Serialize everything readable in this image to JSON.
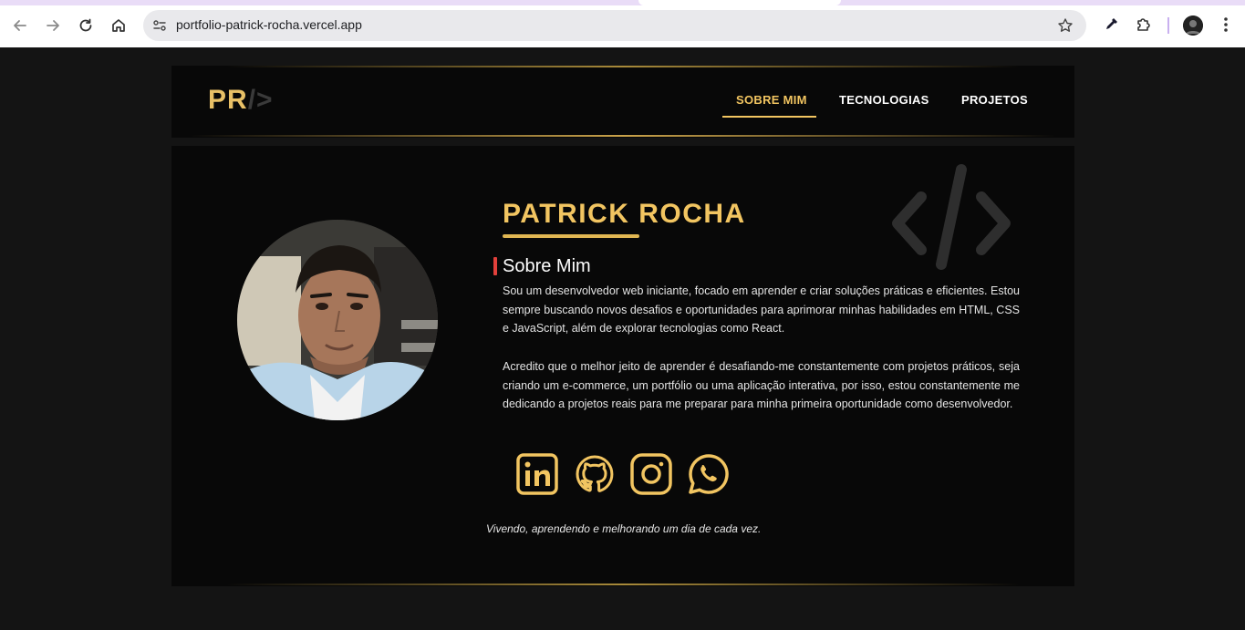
{
  "browser": {
    "url": "portfolio-patrick-rocha.vercel.app",
    "icons": [
      "back-icon",
      "forward-icon",
      "reload-icon",
      "home-icon",
      "site-info-icon",
      "bookmark-star-icon",
      "eyedropper-extension-icon",
      "extensions-puzzle-icon",
      "profile-avatar",
      "menu-kebab-icon"
    ]
  },
  "header": {
    "logo_main": "PR",
    "logo_slash": "/>",
    "nav": [
      {
        "label": "SOBRE MIM",
        "active": true
      },
      {
        "label": "TECNOLOGIAS",
        "active": false
      },
      {
        "label": "PROJETOS",
        "active": false
      }
    ]
  },
  "profile": {
    "name": "PATRICK ROCHA",
    "section_title": "Sobre Mim",
    "paragraph_1": "Sou um desenvolvedor web iniciante, focado em aprender e criar soluções práticas e eficientes. Estou sempre buscando novos desafios e oportunidades para aprimorar minhas habilidades em HTML, CSS e JavaScript, além de explorar tecnologias como React.",
    "paragraph_2": "Acredito que o melhor jeito de aprender é desafiando-me constantemente com projetos práticos, seja criando um e-commerce, um portfólio ou uma aplicação interativa, por isso, estou constantemente me dedicando a projetos reais para me preparar para minha primeira oportunidade como desenvolvedor.",
    "motto": "Vivendo, aprendendo e melhorando um dia de cada vez."
  },
  "social": [
    "linkedin-icon",
    "github-icon",
    "instagram-icon",
    "whatsapp-icon"
  ],
  "colors": {
    "accent": "#f2c561",
    "background": "#141414",
    "panel": "#080808",
    "marker": "#e2403b"
  }
}
